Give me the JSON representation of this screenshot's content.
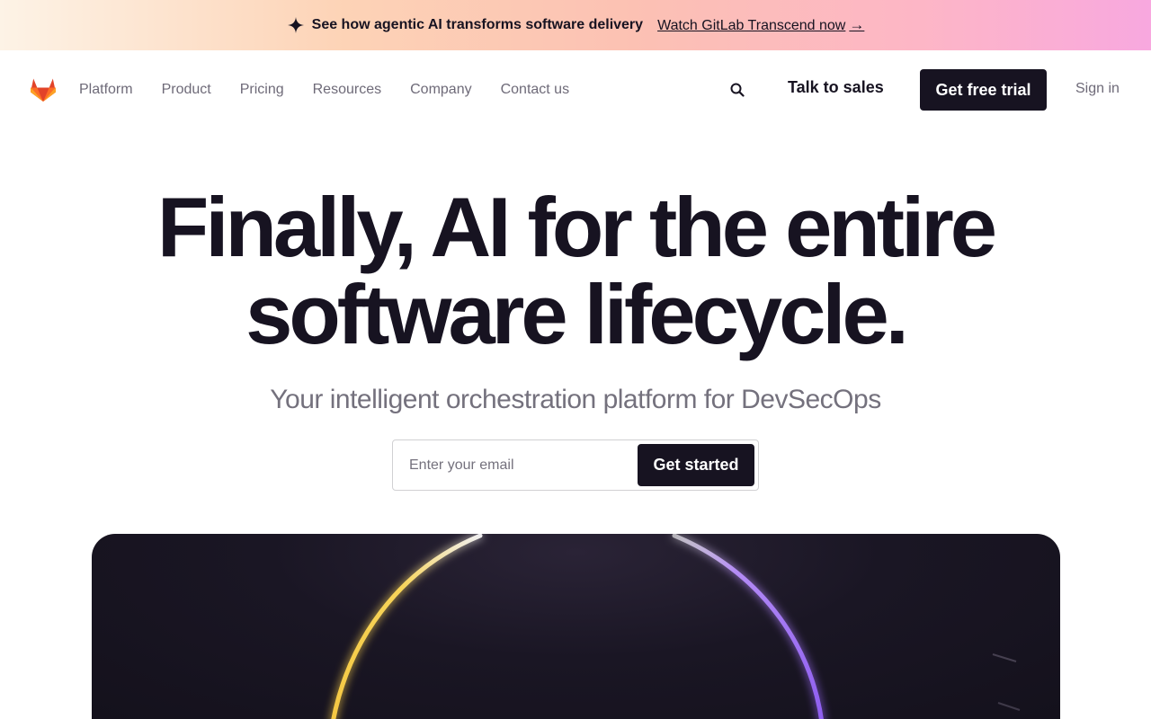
{
  "banner": {
    "icon": "sparkle-icon",
    "headline": "See how agentic AI transforms software delivery",
    "link_label": "Watch GitLab Transcend now",
    "arrow": "→"
  },
  "nav": {
    "logo": "gitlab-tanuki-logo",
    "links": [
      {
        "label": "Platform"
      },
      {
        "label": "Product"
      },
      {
        "label": "Pricing"
      },
      {
        "label": "Resources"
      },
      {
        "label": "Company"
      },
      {
        "label": "Contact us"
      }
    ],
    "search_icon": "search-icon",
    "talk_to_sales": "Talk to sales",
    "free_trial": "Get free trial",
    "sign_in": "Sign in"
  },
  "hero": {
    "title_line1": "Finally, AI for the entire",
    "title_line2": "software lifecycle.",
    "subtitle": "Your intelligent orchestration platform for DevSecOps",
    "email_placeholder": "Enter your email",
    "cta": "Get started"
  },
  "colors": {
    "ink": "#171321",
    "muted": "#6e6a78",
    "accent_orange": "#e24329",
    "glow_yellow": "#f5c842",
    "glow_purple": "#9b6bf2"
  }
}
